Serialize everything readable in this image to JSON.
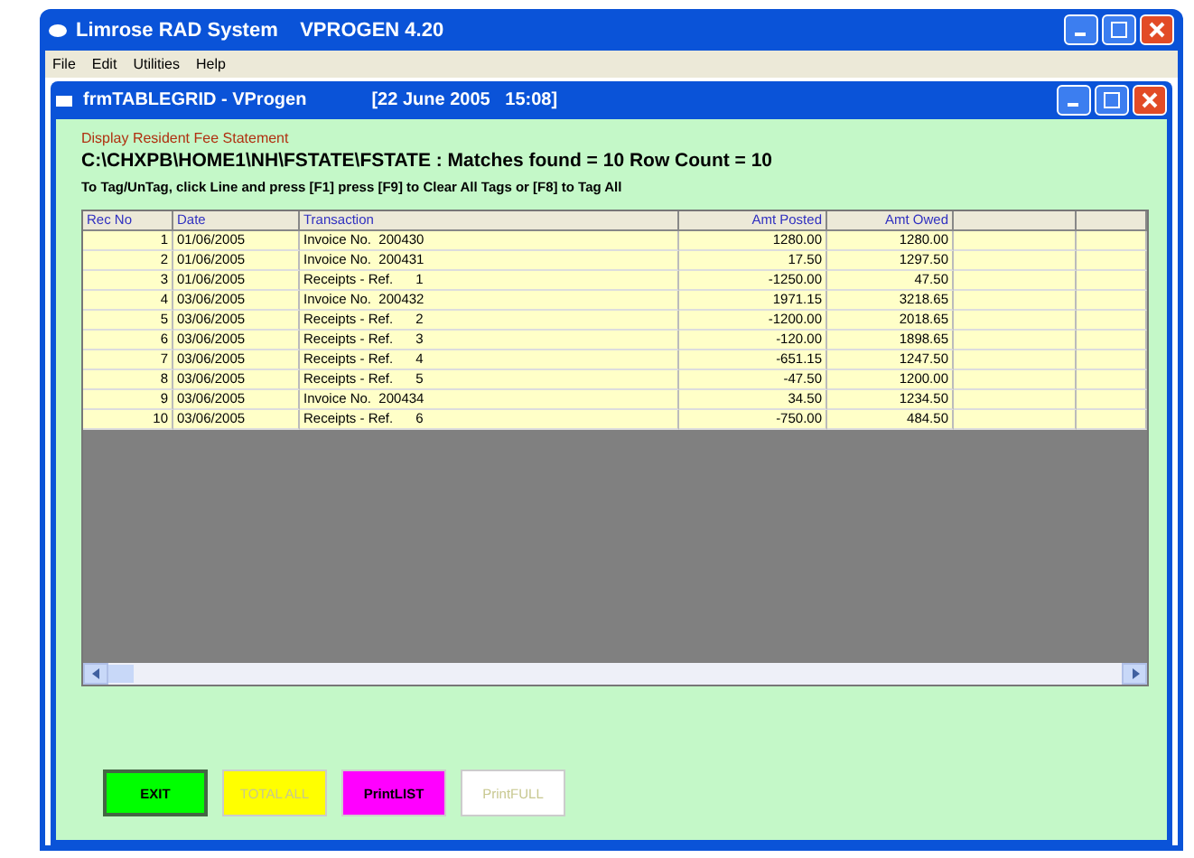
{
  "window": {
    "title": "Limrose RAD System    VPROGEN 4.20"
  },
  "menu": [
    "File",
    "Edit",
    "Utilities",
    "Help"
  ],
  "child_window": {
    "title": "frmTABLEGRID - VProgen",
    "timestamp": "[22 June 2005   15:08]"
  },
  "heading": "Display Resident Fee Statement",
  "path_line": "C:\\CHXPB\\HOME1\\NH\\FSTATE\\FSTATE : Matches found = 10  Row Count = 10",
  "instructions": "To Tag/UnTag, click Line and press [F1]     press [F9] to Clear All Tags or [F8] to Tag All",
  "table": {
    "columns": [
      "Rec No",
      "Date",
      "Transaction",
      "Amt Posted",
      "Amt Owed"
    ],
    "rows": [
      [
        "1",
        "01/06/2005",
        "Invoice No.  200430",
        "1280.00",
        "1280.00"
      ],
      [
        "2",
        "01/06/2005",
        "Invoice No.  200431",
        "17.50",
        "1297.50"
      ],
      [
        "3",
        "01/06/2005",
        "Receipts - Ref.      1",
        "-1250.00",
        "47.50"
      ],
      [
        "4",
        "03/06/2005",
        "Invoice No.  200432",
        "1971.15",
        "3218.65"
      ],
      [
        "5",
        "03/06/2005",
        "Receipts - Ref.      2",
        "-1200.00",
        "2018.65"
      ],
      [
        "6",
        "03/06/2005",
        "Receipts - Ref.      3",
        "-120.00",
        "1898.65"
      ],
      [
        "7",
        "03/06/2005",
        "Receipts - Ref.      4",
        "-651.15",
        "1247.50"
      ],
      [
        "8",
        "03/06/2005",
        "Receipts - Ref.      5",
        "-47.50",
        "1200.00"
      ],
      [
        "9",
        "03/06/2005",
        "Invoice No.  200434",
        "34.50",
        "1234.50"
      ],
      [
        "10",
        "03/06/2005",
        "Receipts - Ref.      6",
        "-750.00",
        "484.50"
      ]
    ]
  },
  "buttons": [
    {
      "label": "EXIT",
      "color": "#00ff00",
      "disabled": false
    },
    {
      "label": "TOTAL ALL",
      "color": "#ffff00",
      "disabled": true
    },
    {
      "label": "PrintLIST",
      "color": "#ff00ff",
      "disabled": false
    },
    {
      "label": "PrintFULL",
      "color": "#ffffff",
      "disabled": true
    }
  ]
}
